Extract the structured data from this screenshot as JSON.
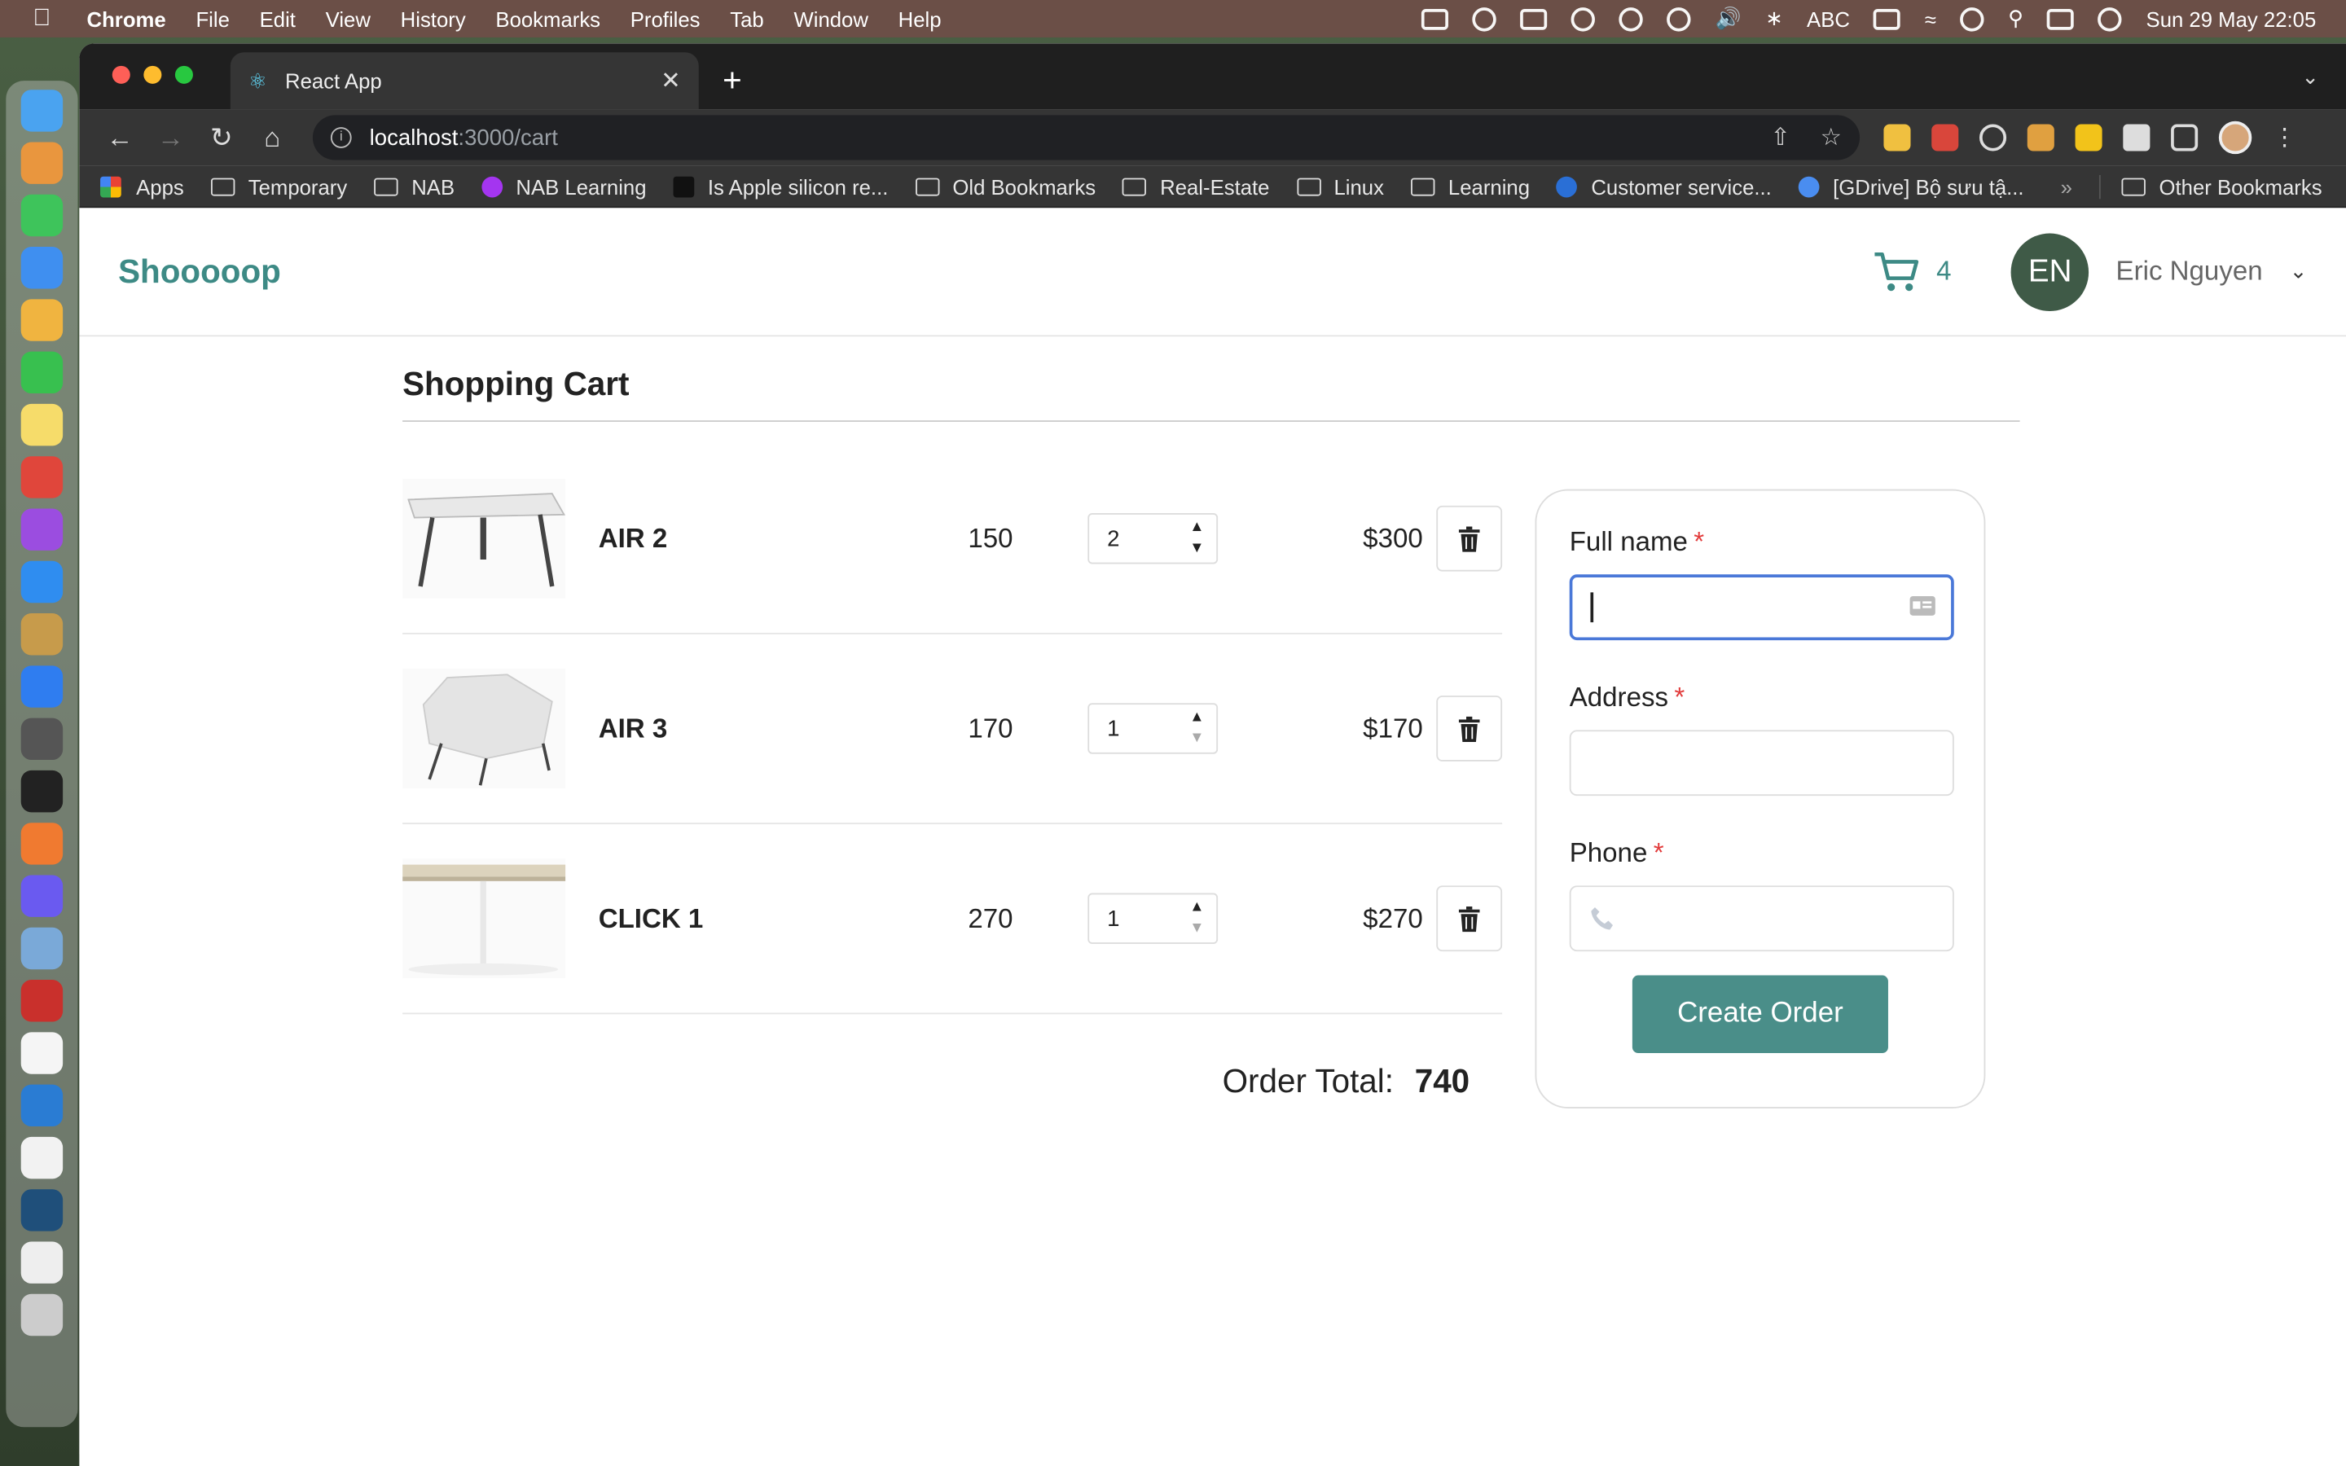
{
  "menubar": {
    "app": "Chrome",
    "items": [
      "File",
      "Edit",
      "View",
      "History",
      "Bookmarks",
      "Profiles",
      "Tab",
      "Window",
      "Help"
    ],
    "input_source": "ABC",
    "datetime": "Sun 29 May  22:05"
  },
  "browser": {
    "tab_title": "React App",
    "url_host": "localhost",
    "url_path": ":3000/cart",
    "bookmarks": [
      {
        "label": "Apps",
        "icon": "apps-grid-icon"
      },
      {
        "label": "Temporary",
        "icon": "folder-icon"
      },
      {
        "label": "NAB",
        "icon": "folder-icon"
      },
      {
        "label": "NAB Learning",
        "icon": "udemy-icon"
      },
      {
        "label": "Is Apple silicon re...",
        "icon": "site-icon"
      },
      {
        "label": "Old Bookmarks",
        "icon": "folder-icon"
      },
      {
        "label": "Real-Estate",
        "icon": "folder-icon"
      },
      {
        "label": "Linux",
        "icon": "folder-icon"
      },
      {
        "label": "Learning",
        "icon": "folder-icon"
      },
      {
        "label": "Customer service...",
        "icon": "paypal-icon"
      },
      {
        "label": "[GDrive] Bộ sưu tậ...",
        "icon": "site-icon"
      }
    ],
    "other_bookmarks": "Other Bookmarks"
  },
  "app": {
    "brand": "Shooooop",
    "cart_count": "4",
    "avatar_initials": "EN",
    "user_name": "Eric Nguyen"
  },
  "cart": {
    "title": "Shopping Cart",
    "items": [
      {
        "name": "AIR 2",
        "price": "150",
        "quantity": "2",
        "total": "$300"
      },
      {
        "name": "AIR 3",
        "price": "170",
        "quantity": "1",
        "total": "$170"
      },
      {
        "name": "CLICK 1",
        "price": "270",
        "quantity": "1",
        "total": "$270"
      }
    ],
    "order_total_label": "Order Total:",
    "order_total_value": "740"
  },
  "form": {
    "full_name_label": "Full name",
    "address_label": "Address",
    "phone_label": "Phone",
    "required_mark": "*",
    "full_name_value": "",
    "address_value": "",
    "phone_value": "",
    "submit_label": "Create Order"
  },
  "colors": {
    "brand": "#3d8a85",
    "button": "#4a8e89",
    "avatar": "#3f5a47",
    "required": "#e23b3b",
    "focus": "#4a78d8"
  }
}
